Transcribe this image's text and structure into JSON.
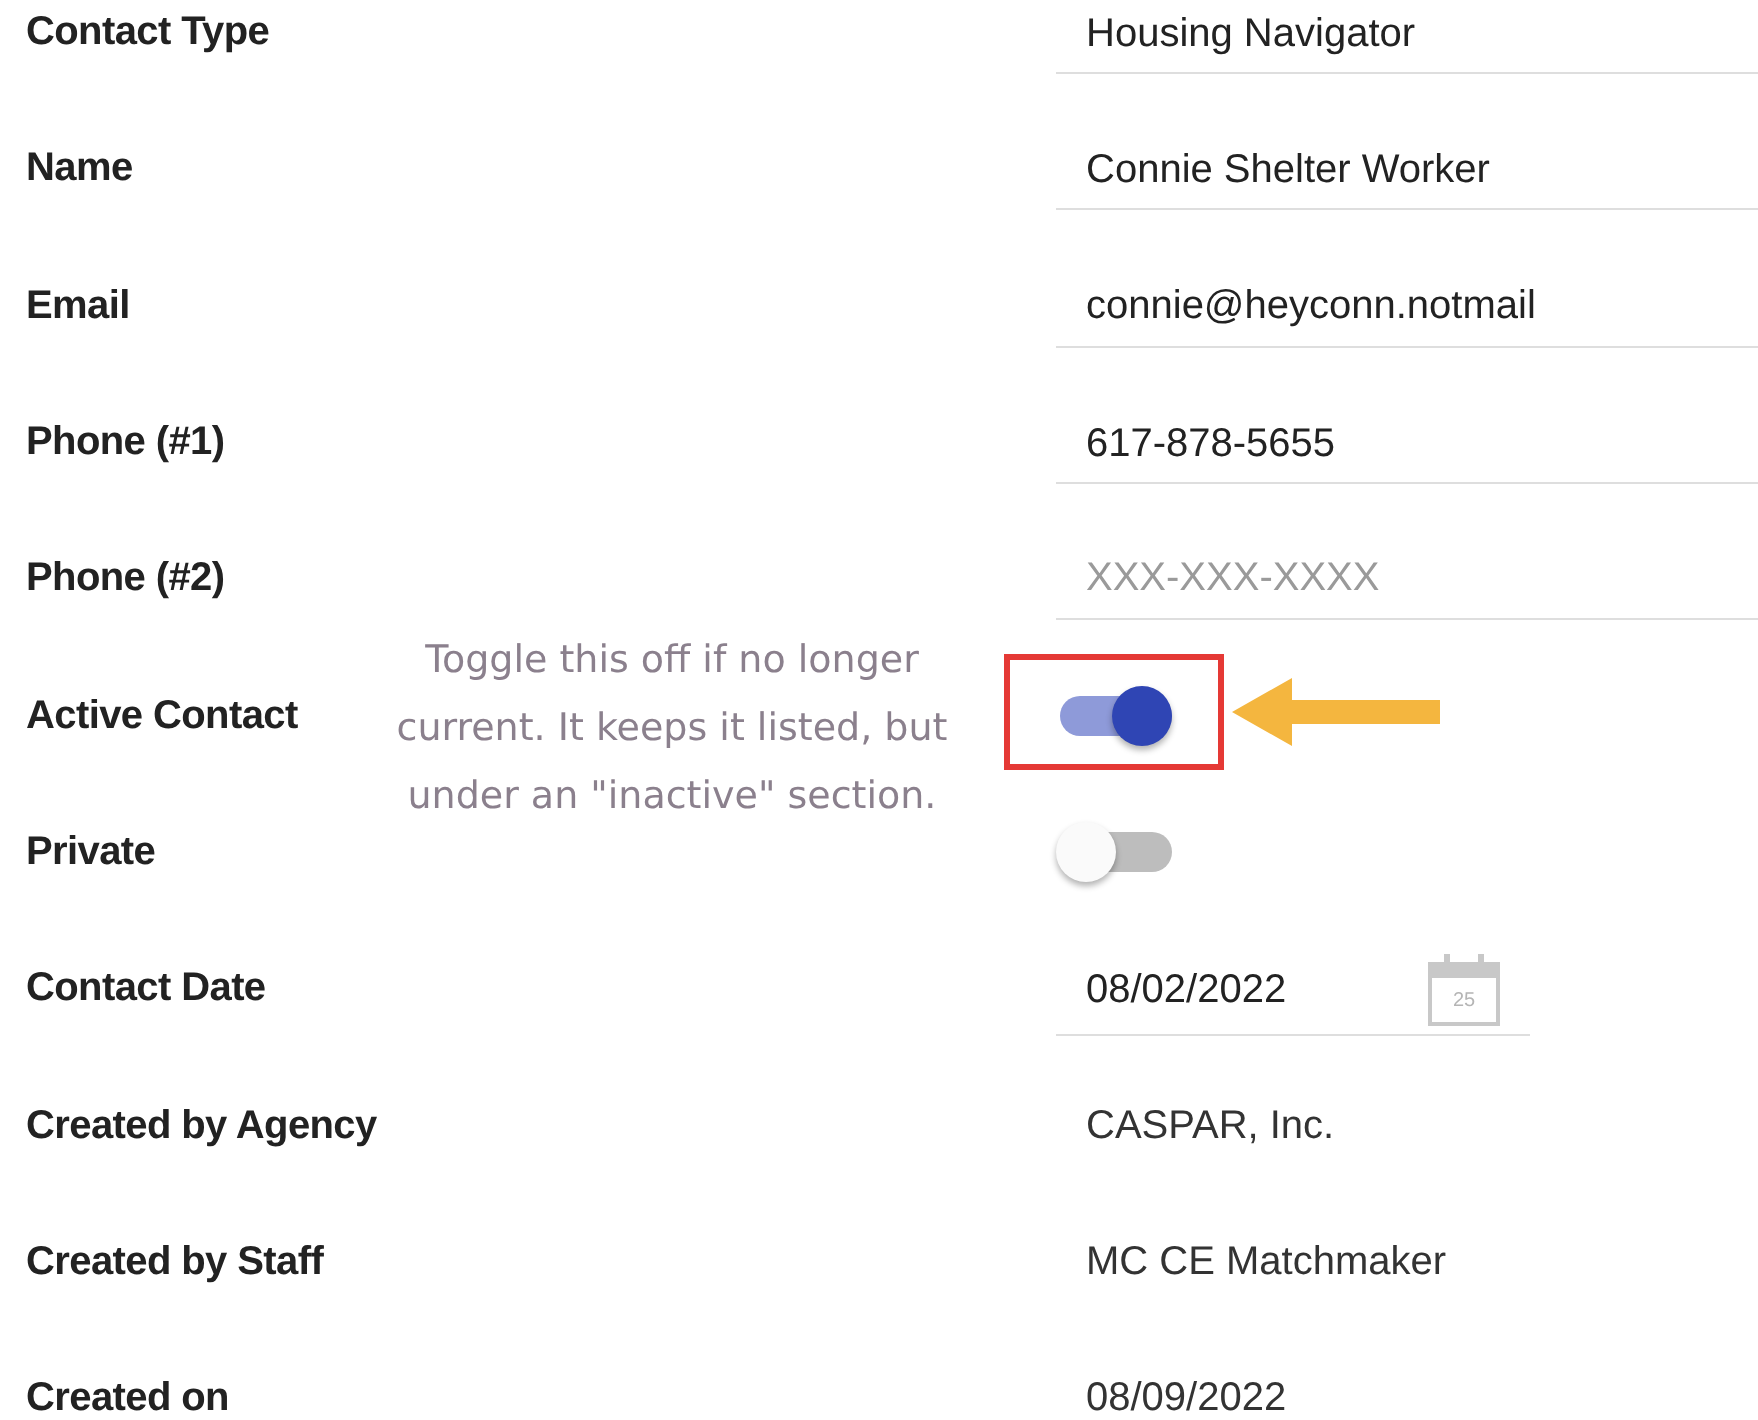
{
  "fields": [
    {
      "kind": "text",
      "label": "Contact Type",
      "value": "Housing Navigator"
    },
    {
      "kind": "text",
      "label": "Name",
      "value": "Connie Shelter Worker"
    },
    {
      "kind": "text",
      "label": "Email",
      "value": "connie@heyconn.notmail"
    },
    {
      "kind": "text",
      "label": "Phone (#1)",
      "value": "617-878-5655"
    },
    {
      "kind": "text",
      "label": "Phone (#2)",
      "placeholder": "XXX-XXX-XXXX"
    },
    {
      "kind": "toggle",
      "label": "Active Contact",
      "on": true
    },
    {
      "kind": "toggle",
      "label": "Private",
      "on": false
    },
    {
      "kind": "date",
      "label": "Contact Date",
      "value": "08/02/2022",
      "calendar_day": "25"
    },
    {
      "kind": "static",
      "label": "Created by Agency",
      "value": "CASPAR, Inc."
    },
    {
      "kind": "static",
      "label": "Created by Staff",
      "value": "MC CE Matchmaker"
    },
    {
      "kind": "static",
      "label": "Created on",
      "value": "08/09/2022"
    }
  ],
  "annotation": {
    "text": "Toggle this off if no longer current. It keeps it listed, but under an \"inactive\" section."
  }
}
